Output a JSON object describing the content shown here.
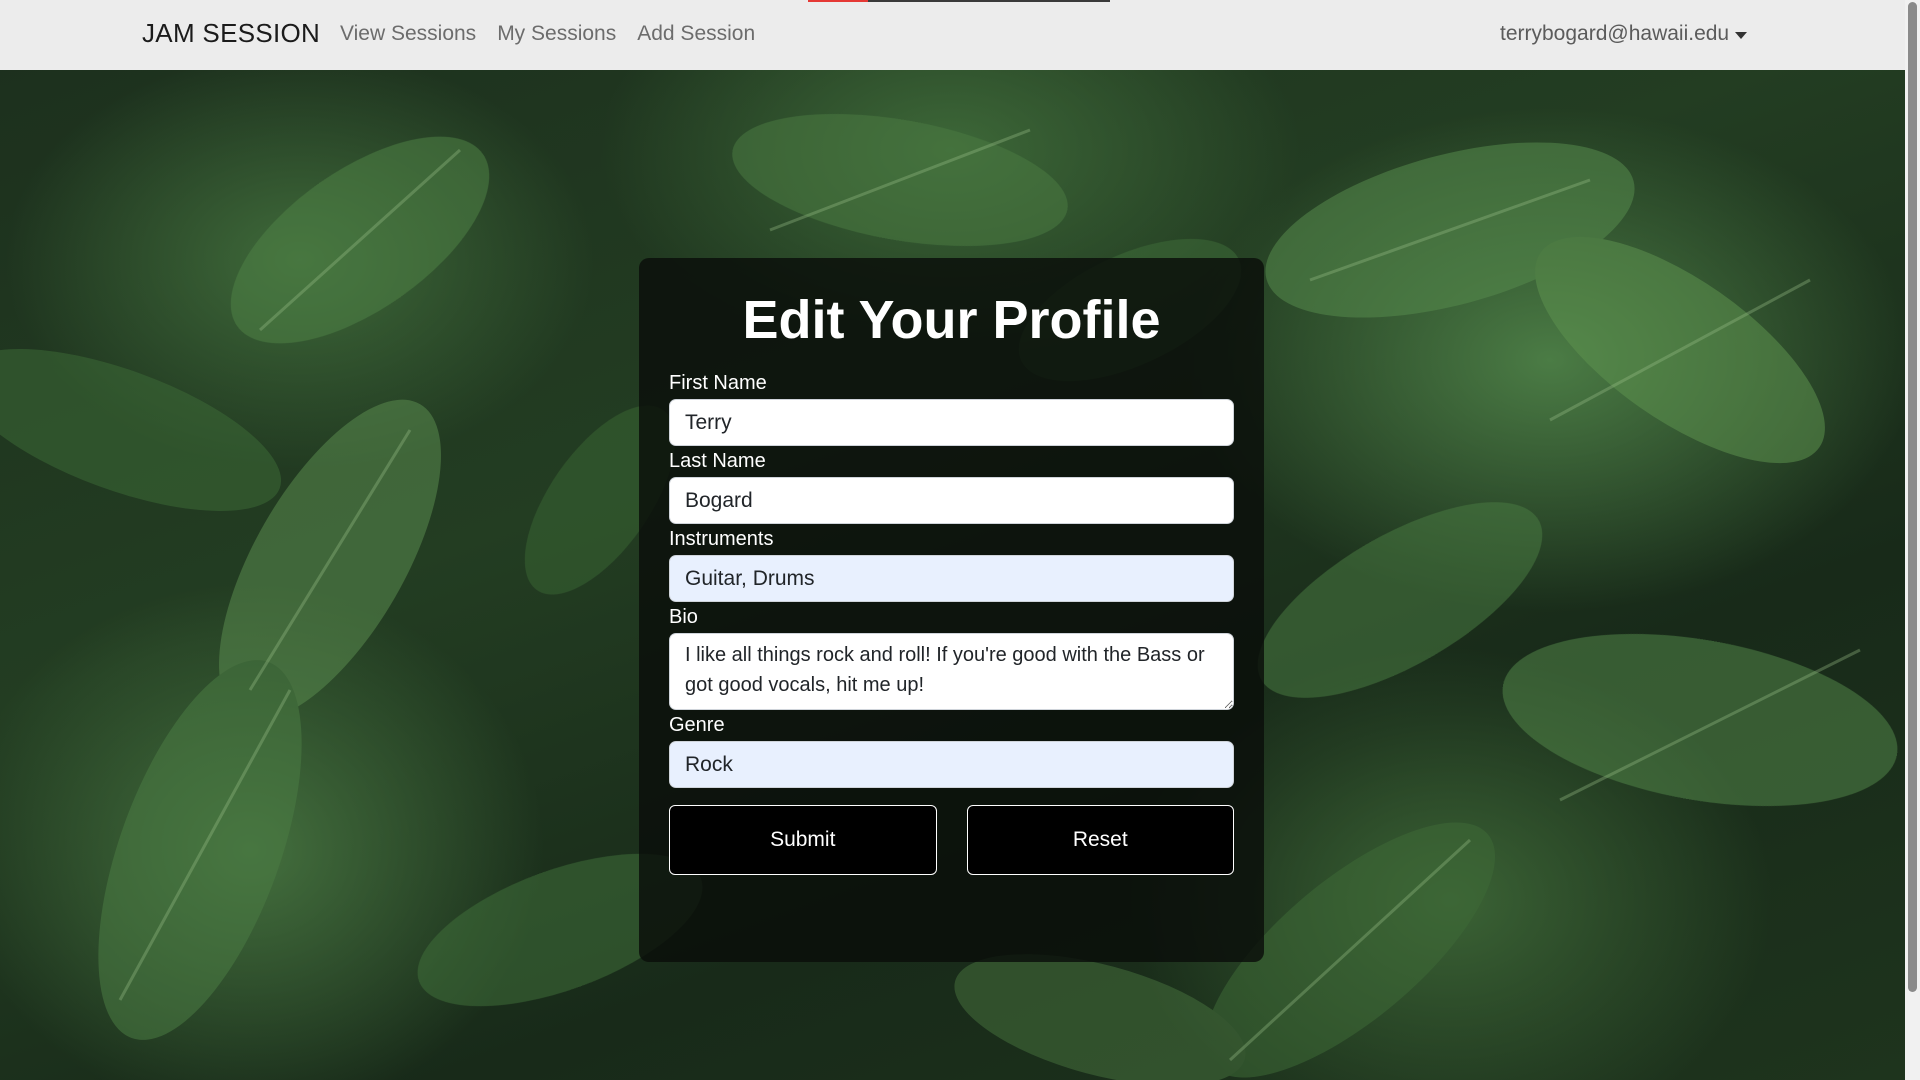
{
  "navbar": {
    "brand": "JAM SESSION",
    "links": [
      "View Sessions",
      "My Sessions",
      "Add Session"
    ],
    "user_email": "terrybogard@hawaii.edu",
    "page_load_progress": 0.2
  },
  "form": {
    "title": "Edit Your Profile",
    "fields": {
      "first_name": {
        "label": "First Name",
        "value": "Terry"
      },
      "last_name": {
        "label": "Last Name",
        "value": "Bogard"
      },
      "instruments": {
        "label": "Instruments",
        "value": "Guitar, Drums"
      },
      "bio": {
        "label": "Bio",
        "value": "I like all things rock and roll! If you're good with the Bass or got good vocals, hit me up!"
      },
      "genre": {
        "label": "Genre",
        "value": "Rock"
      }
    },
    "buttons": {
      "submit": "Submit",
      "reset": "Reset"
    }
  },
  "colors": {
    "navbar_bg": "#ececec",
    "card_bg": "#0a0e0a",
    "autofill_bg": "#e8f0fe",
    "progress_accent": "#e53935"
  }
}
